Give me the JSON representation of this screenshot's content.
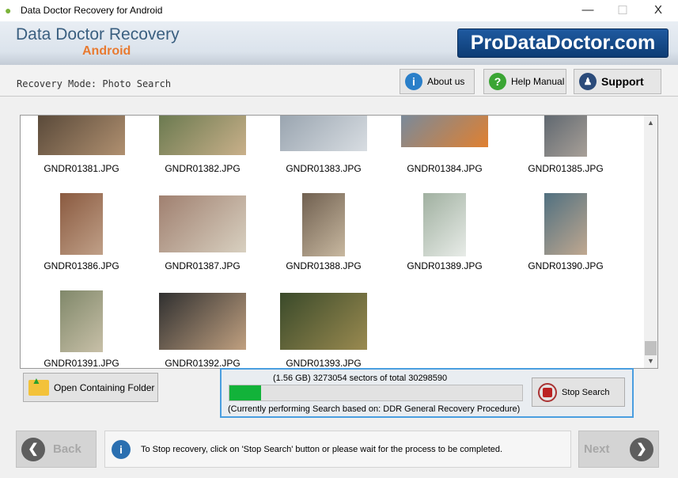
{
  "window": {
    "title": "Data Doctor Recovery for Android",
    "minimize": "—",
    "maximize": "☐",
    "close": "X"
  },
  "header": {
    "brand_line1": "Data Doctor Recovery",
    "brand_line2": "Android",
    "logo": "ProDataDoctor.com",
    "mode": "Recovery Mode: Photo Search",
    "buttons": [
      {
        "label": "About us",
        "icon": "info-icon",
        "glyph": "i",
        "color": "#2a7fc9"
      },
      {
        "label": "Help Manual",
        "icon": "help-icon",
        "glyph": "?",
        "color": "#3aa534"
      },
      {
        "label": "Support",
        "icon": "support-person-icon",
        "glyph": "👤",
        "color": "#2b4b7a"
      }
    ]
  },
  "gallery": {
    "files": [
      "GNDR01381.JPG",
      "GNDR01382.JPG",
      "GNDR01383.JPG",
      "GNDR01384.JPG",
      "GNDR01385.JPG",
      "GNDR01386.JPG",
      "GNDR01387.JPG",
      "GNDR01388.JPG",
      "GNDR01389.JPG",
      "GNDR01390.JPG",
      "GNDR01391.JPG",
      "GNDR01392.JPG",
      "GNDR01393.JPG"
    ]
  },
  "open_folder": "Open Containing Folder",
  "progress": {
    "status": "(1.56 GB) 3273054  sectors  of  total 30298590",
    "percent": 10.8,
    "procedure": "(Currently performing Search based on:  DDR General Recovery Procedure)",
    "stop_label": "Stop Search",
    "color": "#12b33a"
  },
  "footer": {
    "back": "Back",
    "next": "Next",
    "message": "To Stop recovery, click on 'Stop Search' button or please wait for the process to be completed."
  }
}
